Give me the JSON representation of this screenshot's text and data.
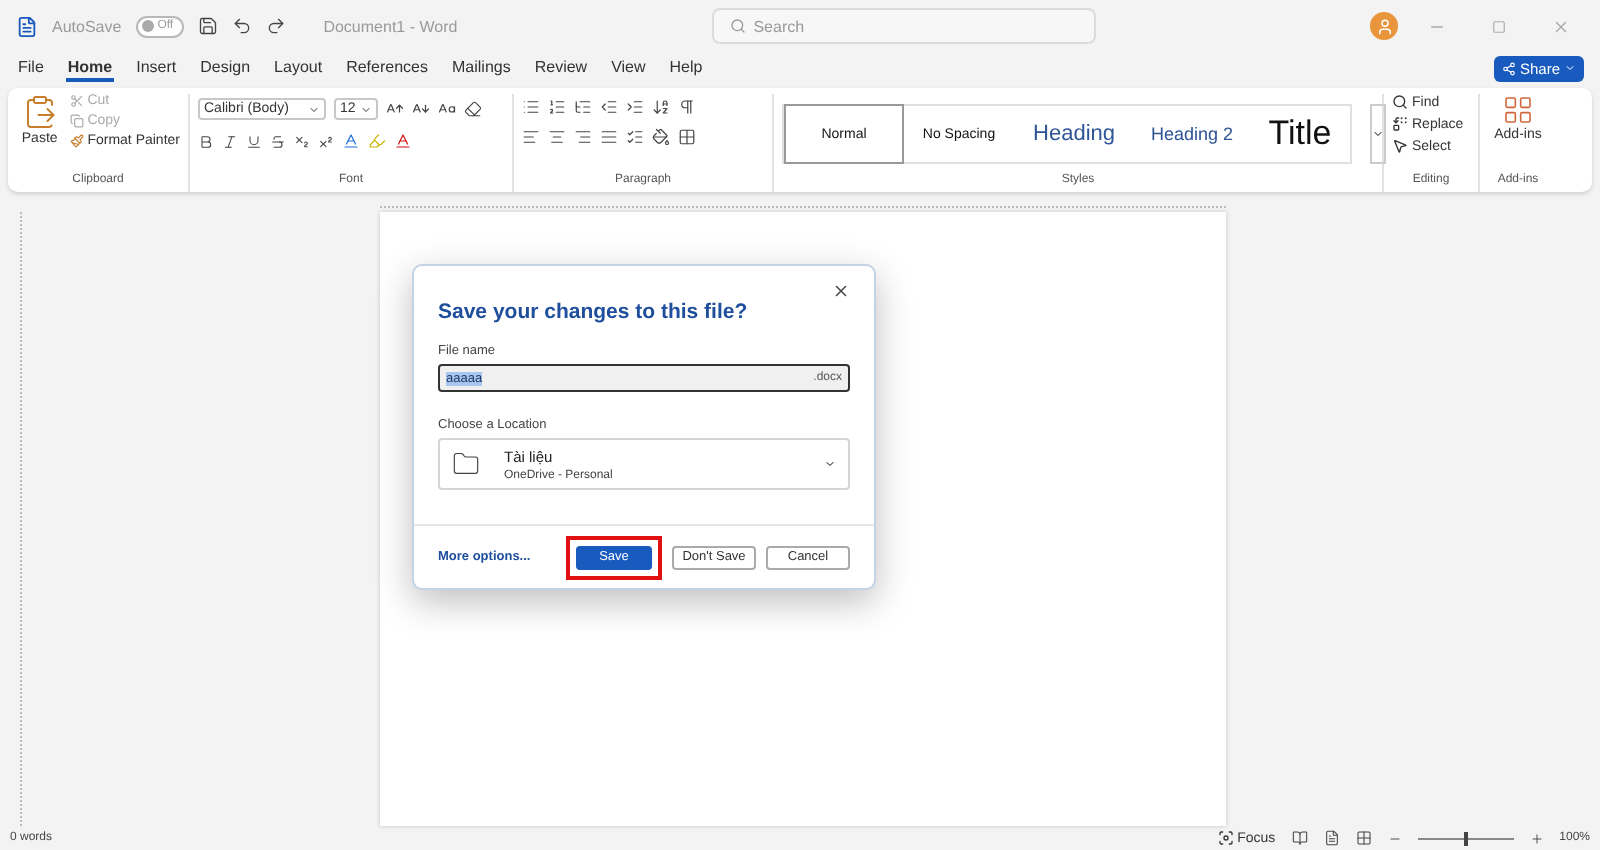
{
  "title_bar": {
    "autosave_label": "AutoSave",
    "autosave": {
      "label": "Off",
      "on": false
    },
    "document_title": "Document1  -  Word",
    "search": {
      "placeholder": "Search"
    }
  },
  "tabs": [
    {
      "label": "File",
      "selected": false
    },
    {
      "label": "Home",
      "selected": true
    },
    {
      "label": "Insert",
      "selected": false
    },
    {
      "label": "Design",
      "selected": false
    },
    {
      "label": "Layout",
      "selected": false
    },
    {
      "label": "References",
      "selected": false
    },
    {
      "label": "Mailings",
      "selected": false
    },
    {
      "label": "Review",
      "selected": false
    },
    {
      "label": "View",
      "selected": false
    },
    {
      "label": "Help",
      "selected": false
    }
  ],
  "share_button": "Share",
  "ribbon": {
    "clipboard": {
      "paste": "Paste",
      "cut": {
        "label": "Cut",
        "disabled": true
      },
      "copy": {
        "label": "Copy",
        "disabled": true
      },
      "format_painter": {
        "label": "Format Painter",
        "disabled": false
      },
      "label": "Clipboard"
    },
    "font": {
      "font_name": "Calibri (Body)",
      "font_size": "12",
      "label": "Font"
    },
    "paragraph": {
      "label": "Paragraph"
    },
    "styles": {
      "items": [
        {
          "label": "Normal",
          "kind": "normal",
          "selected": true
        },
        {
          "label": "No Spacing",
          "kind": "nospacing",
          "selected": false
        },
        {
          "label": "Heading",
          "kind": "heading1",
          "selected": false
        },
        {
          "label": "Heading 2",
          "kind": "heading2",
          "selected": false
        },
        {
          "label": "Title",
          "kind": "title",
          "selected": false
        }
      ],
      "label": "Styles"
    },
    "editing": {
      "find": "Find",
      "replace": "Replace",
      "select": "Select",
      "label": "Editing"
    },
    "addins": {
      "button": "Add-ins",
      "label": "Add-ins"
    }
  },
  "dialog": {
    "title": "Save your changes to this file?",
    "file_name_label": "File name",
    "file_name": "aaaaa",
    "extension": ".docx",
    "location_label": "Choose a Location",
    "location": {
      "name": "Tài liệu",
      "detail": "OneDrive - Personal"
    },
    "more_options": "More options...",
    "buttons": [
      {
        "label": "Save",
        "kind": "primary",
        "highlighted": true
      },
      {
        "label": "Don't Save",
        "kind": "secondary",
        "highlighted": false
      },
      {
        "label": "Cancel",
        "kind": "secondary",
        "highlighted": false
      }
    ]
  },
  "status_bar": {
    "words": "0 words",
    "focus": "Focus",
    "zoom": {
      "level": 0.5,
      "reading": "100%"
    }
  }
}
